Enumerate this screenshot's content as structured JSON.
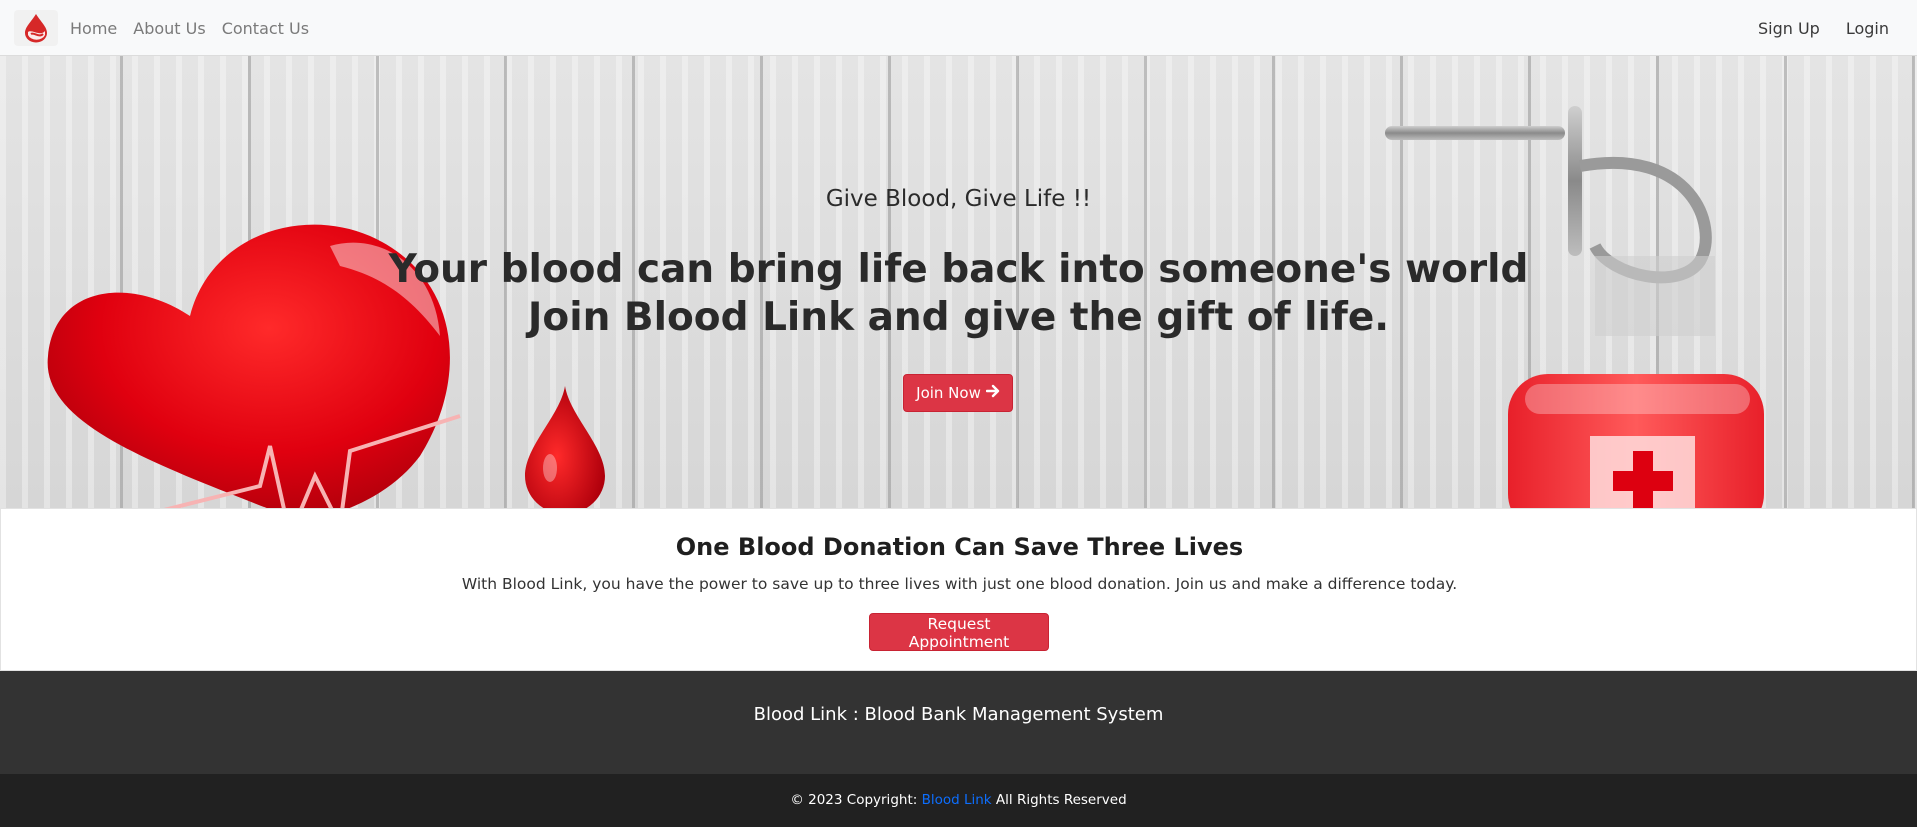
{
  "navbar": {
    "logo_icon": "blood-drop-icon",
    "links": [
      {
        "label": "Home"
      },
      {
        "label": "About Us"
      },
      {
        "label": "Contact Us"
      }
    ],
    "auth": {
      "signup_label": "Sign Up",
      "login_label": "Login"
    }
  },
  "hero": {
    "tagline": "Give Blood, Give Life !!",
    "headline_line1": "Your blood can bring life back into someone's world",
    "headline_line2": "Join Blood Link and give the gift of life.",
    "cta_label": "Join Now",
    "cta_icon": "arrow-right-icon"
  },
  "info": {
    "heading": "One Blood Donation Can Save Three Lives",
    "description": "With Blood Link, you have the power to save up to three lives with just one blood donation. Join us and make a difference today.",
    "button_label": "Request Appointment"
  },
  "footer": {
    "title": "Blood Link : Blood Bank Management System",
    "copyright_prefix": "© 2023 Copyright:",
    "copyright_link": "Blood Link",
    "copyright_suffix": "All Rights Reserved"
  },
  "colors": {
    "primary_red": "#dc3545",
    "navbar_bg": "#f8f9fa",
    "footer_bg": "#333333",
    "footer_bottom_bg": "#212121",
    "link_blue": "#0d6efd"
  }
}
